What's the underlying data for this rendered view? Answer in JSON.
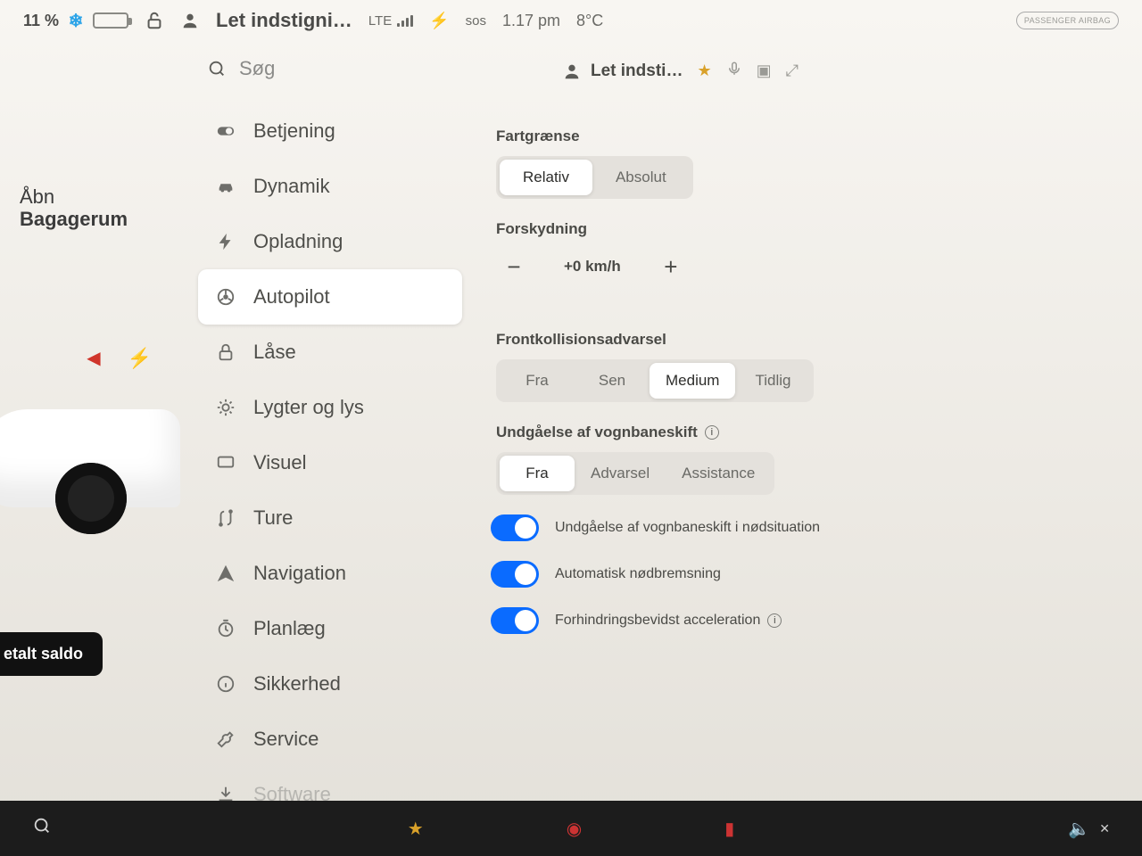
{
  "statusbar": {
    "battery_percent": "11 %",
    "profile_label": "Let indstigni…",
    "network": "LTE",
    "sos": "sos",
    "time": "1.17 pm",
    "temp": "8°C",
    "badge_label": "PASSENGER AIRBAG"
  },
  "vehicle": {
    "open_label": "Åbn",
    "trunk_label": "Bagagerum",
    "balance_button": "etalt saldo"
  },
  "search": {
    "placeholder": "Søg"
  },
  "nav_items": [
    {
      "id": "controls",
      "label": "Betjening",
      "icon": "toggle"
    },
    {
      "id": "dynamics",
      "label": "Dynamik",
      "icon": "car"
    },
    {
      "id": "charging",
      "label": "Opladning",
      "icon": "bolt"
    },
    {
      "id": "autopilot",
      "label": "Autopilot",
      "icon": "wheel",
      "active": true
    },
    {
      "id": "locks",
      "label": "Låse",
      "icon": "lock"
    },
    {
      "id": "lights",
      "label": "Lygter og lys",
      "icon": "sun"
    },
    {
      "id": "display",
      "label": "Visuel",
      "icon": "display"
    },
    {
      "id": "trips",
      "label": "Ture",
      "icon": "route"
    },
    {
      "id": "navigation",
      "label": "Navigation",
      "icon": "nav"
    },
    {
      "id": "schedule",
      "label": "Planlæg",
      "icon": "timer"
    },
    {
      "id": "safety",
      "label": "Sikkerhed",
      "icon": "info"
    },
    {
      "id": "service",
      "label": "Service",
      "icon": "wrench"
    },
    {
      "id": "software",
      "label": "Software",
      "icon": "soft"
    }
  ],
  "detail": {
    "profile_label": "Let indsti…",
    "speed_limit_label": "Fartgrænse",
    "speed_limit_options": [
      "Relativ",
      "Absolut"
    ],
    "speed_limit_selected": 0,
    "offset_label": "Forskydning",
    "offset_value": "+0 km/h",
    "fcw_label": "Frontkollisionsadvarsel",
    "fcw_options": [
      "Fra",
      "Sen",
      "Medium",
      "Tidlig"
    ],
    "fcw_selected": 2,
    "lda_label": "Undgåelse af vognbaneskift",
    "lda_options": [
      "Fra",
      "Advarsel",
      "Assistance"
    ],
    "lda_selected": 0,
    "toggles": [
      {
        "label": "Undgåelse af vognbaneskift i nødsituation",
        "on": true
      },
      {
        "label": "Automatisk nødbremsning",
        "on": true
      },
      {
        "label": "Forhindringsbevidst acceleration",
        "on": true,
        "info": true
      }
    ]
  }
}
